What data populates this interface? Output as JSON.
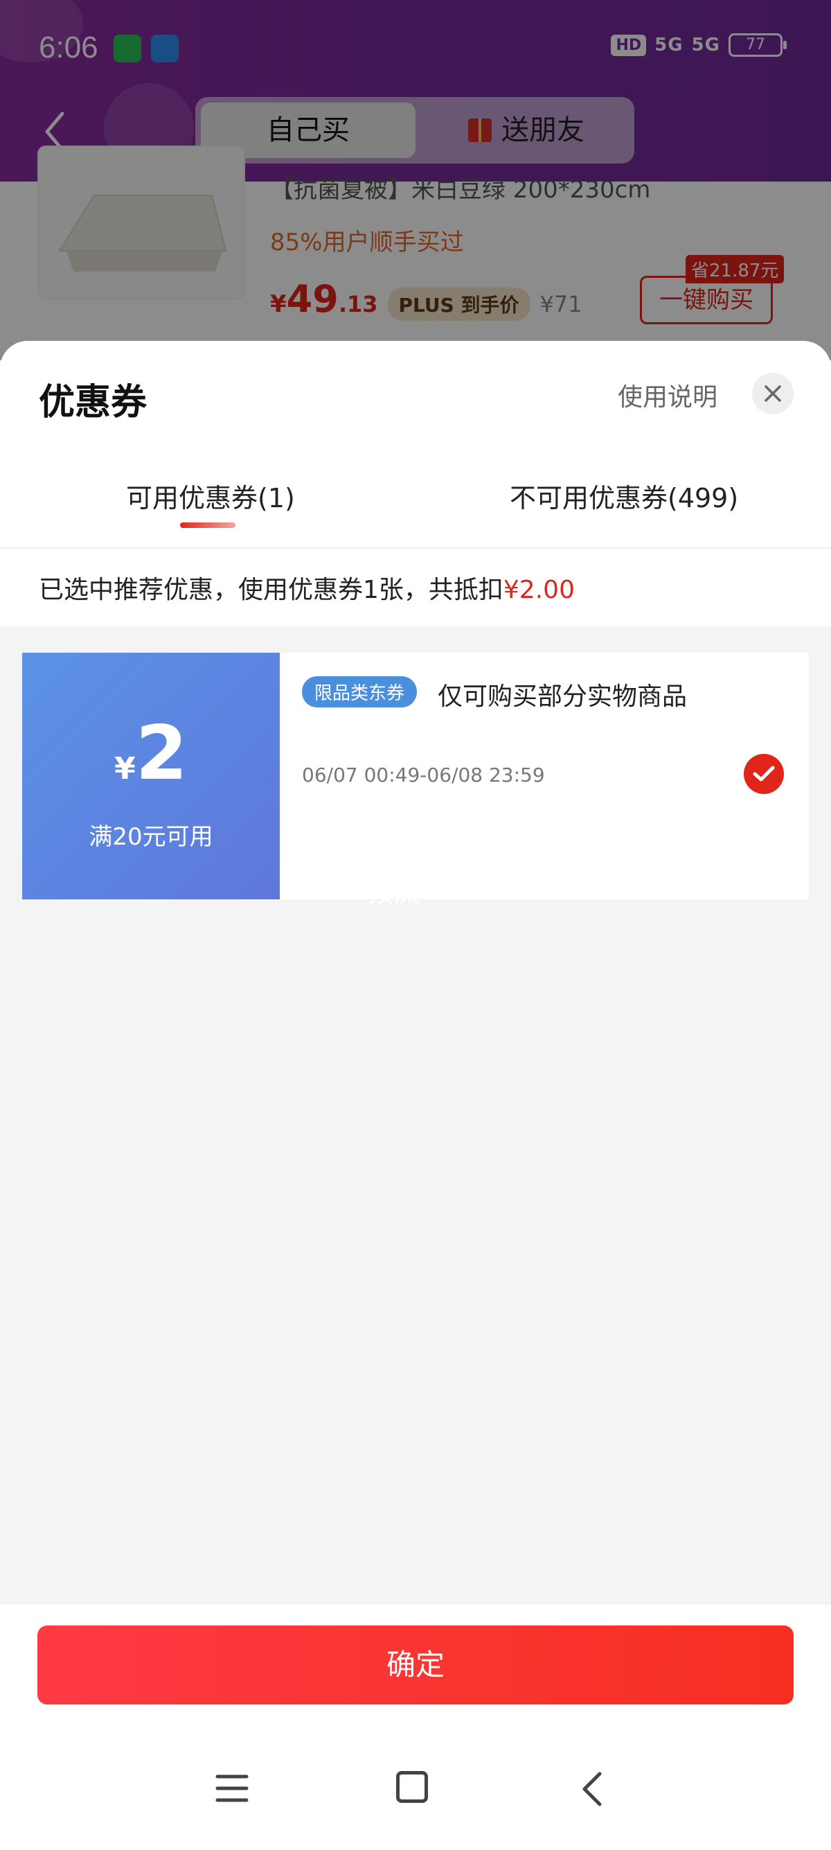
{
  "status_bar": {
    "time": "6:06",
    "hd_badge": "HD",
    "network_1": "5G",
    "network_2": "5G",
    "battery": "77"
  },
  "header": {
    "tabs": {
      "self_buy": "自己买",
      "gift": "送朋友"
    }
  },
  "product": {
    "title": "【抗菌夏被】米白豆绿  200*230cm",
    "bought_info": "85%用户顺手买过",
    "price_symbol": "¥",
    "price_int": "49",
    "price_dec": ".13",
    "plus_tag": "PLUS 到手价",
    "original_price": "¥71",
    "save_tag": "省21.87元",
    "buy_button": "一键购买"
  },
  "sheet": {
    "title": "优惠券",
    "usage_link": "使用说明",
    "tabs": {
      "available": "可用优惠券(1)",
      "unavailable": "不可用优惠券(499)"
    },
    "summary_prefix": "已选中推荐优惠，使用优惠券1张，共抵扣",
    "summary_amount": "¥2.00"
  },
  "coupon": {
    "symbol": "¥",
    "amount": "2",
    "condition": "满20元可用",
    "tag": "限品类东券",
    "description": "仅可购买部分实物商品",
    "validity": "06/07 00:49-06/08 23:59",
    "selected": true,
    "watermark": "顶流"
  },
  "footer": {
    "confirm_button": "确定"
  },
  "colors": {
    "accent_red": "#e1251b",
    "header_purple": "#7a2a9c",
    "coupon_blue": "#5a93e6"
  },
  "icons": [
    "back-chevron-icon",
    "gift-icon",
    "close-icon",
    "check-icon",
    "menu-icon",
    "home-icon",
    "nav-back-icon"
  ]
}
